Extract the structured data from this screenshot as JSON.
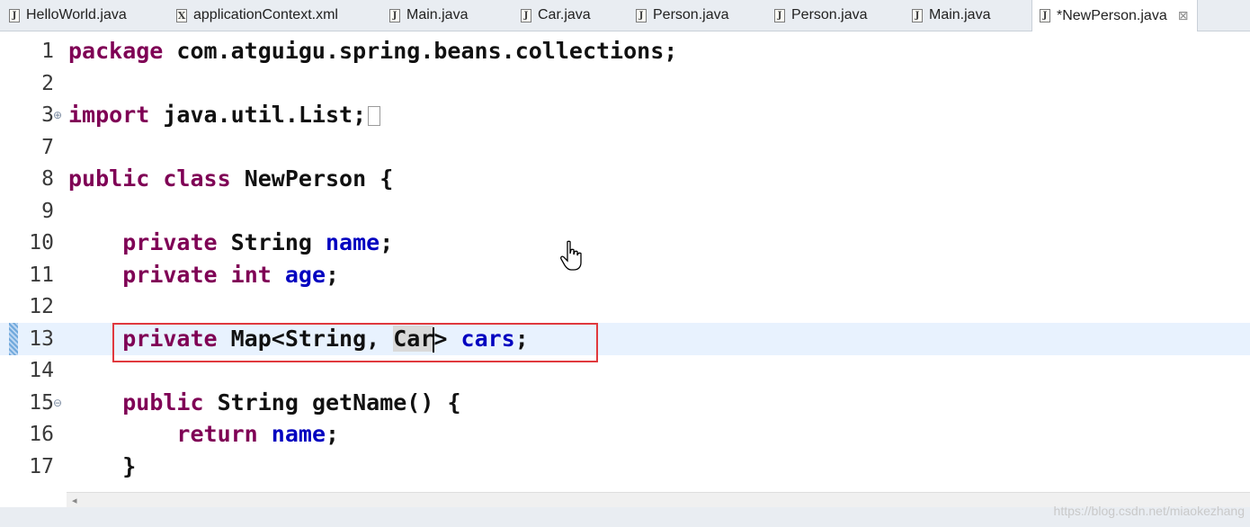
{
  "tabs": [
    {
      "label": "HelloWorld.java",
      "icon": "java-file-icon"
    },
    {
      "label": "applicationContext.xml",
      "icon": "xml-file-icon"
    },
    {
      "label": "Main.java",
      "icon": "java-file-icon"
    },
    {
      "label": "Car.java",
      "icon": "java-file-icon"
    },
    {
      "label": "Person.java",
      "icon": "java-file-icon"
    },
    {
      "label": "Person.java",
      "icon": "java-file-icon"
    },
    {
      "label": "Main.java",
      "icon": "java-file-icon"
    },
    {
      "label": "*NewPerson.java",
      "icon": "java-file-icon",
      "active": true,
      "close": "⊠"
    }
  ],
  "editor": {
    "lines": [
      {
        "num": "1",
        "parts": [
          {
            "t": "package",
            "c": "kw"
          },
          {
            "t": " com.atguigu.spring.beans.collections;"
          }
        ]
      },
      {
        "num": "2",
        "parts": []
      },
      {
        "num": "3",
        "marker": "⊕",
        "parts": [
          {
            "t": "import",
            "c": "kw"
          },
          {
            "t": " java.util.List;"
          }
        ],
        "folded": true
      },
      {
        "num": "7",
        "parts": []
      },
      {
        "num": "8",
        "parts": [
          {
            "t": "public",
            "c": "kw"
          },
          {
            "t": " "
          },
          {
            "t": "class",
            "c": "kw"
          },
          {
            "t": " NewPerson {"
          }
        ]
      },
      {
        "num": "9",
        "parts": []
      },
      {
        "num": "10",
        "parts": [
          {
            "t": "    "
          },
          {
            "t": "private",
            "c": "kw"
          },
          {
            "t": " String "
          },
          {
            "t": "name",
            "c": "fld"
          },
          {
            "t": ";"
          }
        ]
      },
      {
        "num": "11",
        "parts": [
          {
            "t": "    "
          },
          {
            "t": "private",
            "c": "kw"
          },
          {
            "t": " "
          },
          {
            "t": "int",
            "c": "kw"
          },
          {
            "t": " "
          },
          {
            "t": "age",
            "c": "fld"
          },
          {
            "t": ";"
          }
        ]
      },
      {
        "num": "12",
        "parts": []
      },
      {
        "num": "13",
        "current": true,
        "parts": [
          {
            "t": "    "
          },
          {
            "t": "private",
            "c": "kw"
          },
          {
            "t": " Map<String, "
          },
          {
            "t": "Car",
            "c": "sel"
          },
          {
            "t": "|",
            "c": "caret"
          },
          {
            "t": "> "
          },
          {
            "t": "cars",
            "c": "fld"
          },
          {
            "t": ";"
          }
        ]
      },
      {
        "num": "14",
        "parts": []
      },
      {
        "num": "15",
        "marker": "⊖",
        "parts": [
          {
            "t": "    "
          },
          {
            "t": "public",
            "c": "kw"
          },
          {
            "t": " String getName() {"
          }
        ]
      },
      {
        "num": "16",
        "parts": [
          {
            "t": "        "
          },
          {
            "t": "return",
            "c": "kw"
          },
          {
            "t": " "
          },
          {
            "t": "name",
            "c": "fld"
          },
          {
            "t": ";"
          }
        ]
      },
      {
        "num": "17",
        "parts": [
          {
            "t": "    }"
          }
        ]
      }
    ]
  },
  "watermark": "https://blog.csdn.net/miaokezhang",
  "colors": {
    "keyword": "#7f0055",
    "field": "#0000c0",
    "highlight_box": "#e0393e"
  }
}
